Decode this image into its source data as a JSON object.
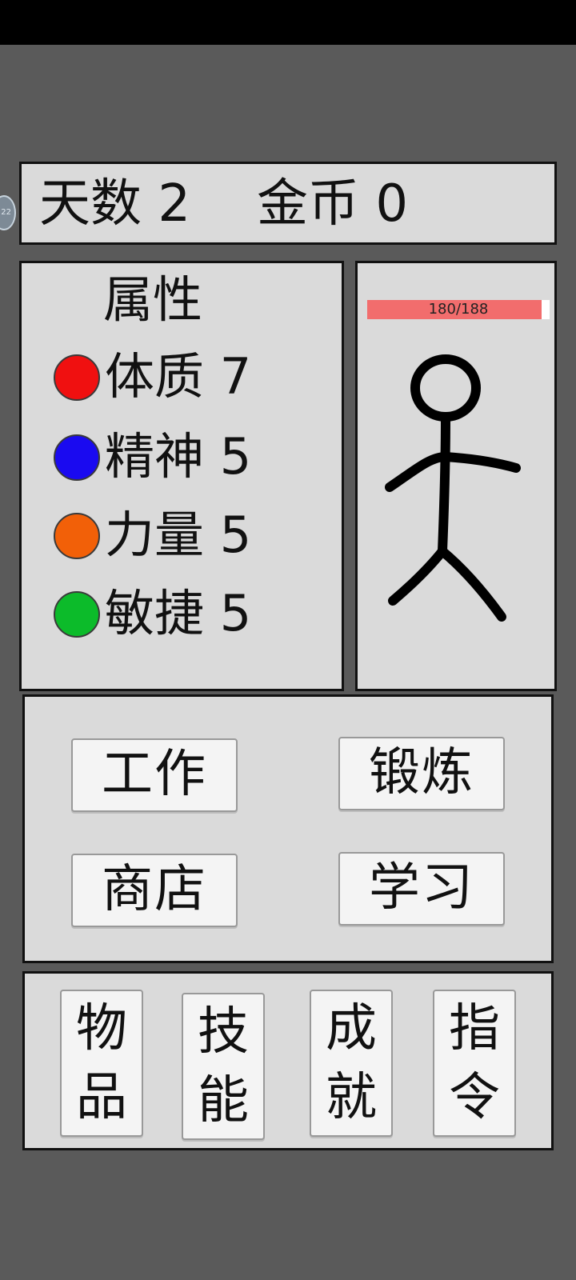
{
  "status_bar": {},
  "side_badge": "22",
  "header": {
    "days_text": "天数 2",
    "gold_text": "金币 0"
  },
  "attributes": {
    "title": "属性",
    "items": [
      {
        "label": "体质 7",
        "color": "#f01010"
      },
      {
        "label": "精神 5",
        "color": "#1a0af0"
      },
      {
        "label": "力量 5",
        "color": "#f26008"
      },
      {
        "label": "敏捷 5",
        "color": "#0cbb2a"
      }
    ]
  },
  "character": {
    "hp_text": "180/188",
    "hp_current": 180,
    "hp_max": 188,
    "hp_color": "#f26d6d"
  },
  "actions": {
    "work": "工作",
    "train": "锻炼",
    "shop": "商店",
    "study": "学习"
  },
  "menu": {
    "items": "物品",
    "skills": "技能",
    "achievements": "成就",
    "commands": "指令"
  }
}
